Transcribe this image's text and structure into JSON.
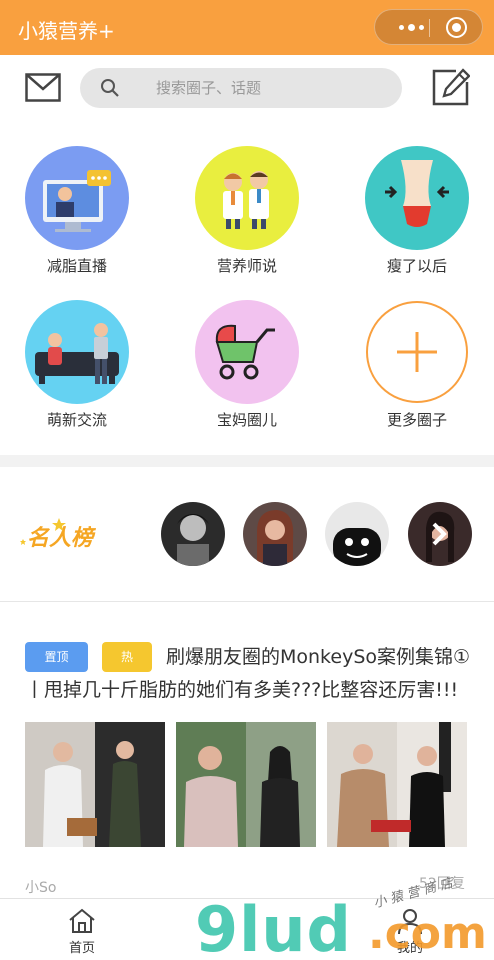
{
  "app": {
    "title": "小猿营养+"
  },
  "header": {
    "search_placeholder": "搜索圈子、话题"
  },
  "categories": [
    {
      "label": "减脂直播",
      "icon": "live-stream-icon",
      "color": "#7b9cf2"
    },
    {
      "label": "营养师说",
      "icon": "nutritionists-icon",
      "color": "#e9ee3f"
    },
    {
      "label": "瘦了以后",
      "icon": "waist-slim-icon",
      "color": "#40c7c5"
    },
    {
      "label": "萌新交流",
      "icon": "sofa-chat-icon",
      "color": "#65d2f2"
    },
    {
      "label": "宝妈圈儿",
      "icon": "stroller-icon",
      "color": "#f2c2ef"
    },
    {
      "label": "更多圈子",
      "icon": "plus-icon",
      "color": "#f9a03f"
    }
  ],
  "fame": {
    "label": "名人榜"
  },
  "post": {
    "tags": [
      "置顶",
      "热"
    ],
    "title": "刷爆朋友圈的MonkeySo案例集锦①丨甩掉几十斤脂肪的她们有多美???比整容还厉害!!!",
    "author": "小So",
    "replies": "52回复"
  },
  "tabs": [
    {
      "label": "首页",
      "icon": "home-icon"
    },
    {
      "label": "我的",
      "icon": "user-icon"
    }
  ],
  "watermark": {
    "main": "9lud",
    "suffix": ".com",
    "shop": "小 猿 营 商 店"
  },
  "colors": {
    "primary": "#f9a03f",
    "tag_top": "#5b9cf0",
    "tag_hot": "#f5c72f"
  }
}
